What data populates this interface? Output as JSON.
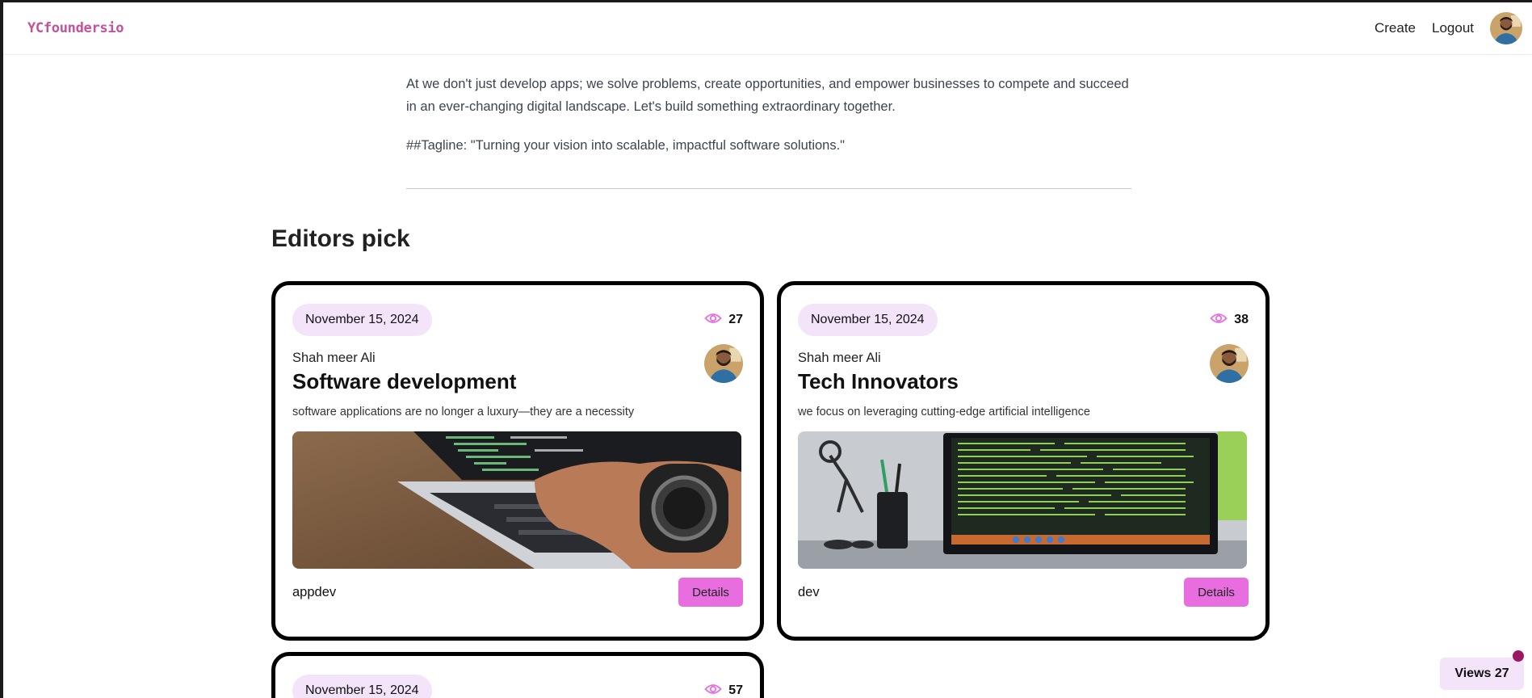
{
  "header": {
    "logo": "YCfoundersio",
    "nav": {
      "create": "Create",
      "logout": "Logout"
    }
  },
  "description": {
    "paragraph": "At we don't just develop apps; we solve problems, create opportunities, and empower businesses to compete and succeed in an ever-changing digital landscape. Let's build something extraordinary together.",
    "tagline": "##Tagline: \"Turning your vision into scalable, impactful software solutions.\""
  },
  "section_title": "Editors pick",
  "cards": [
    {
      "date": "November 15, 2024",
      "views": "27",
      "author": "Shah meer Ali",
      "title": "Software development",
      "description": "software applications are no longer a luxury—they are a necessity",
      "category": "appdev",
      "details_label": "Details"
    },
    {
      "date": "November 15, 2024",
      "views": "38",
      "author": "Shah meer Ali",
      "title": "Tech Innovators",
      "description": "we focus on leveraging cutting-edge artificial intelligence",
      "category": "dev",
      "details_label": "Details"
    },
    {
      "date": "November 15, 2024",
      "views": "57"
    }
  ],
  "views_badge": "Views 27",
  "icons": {
    "views": "eye-icon",
    "avatar": "user-avatar"
  },
  "colors": {
    "accent": "#e86ee0",
    "pill_bg": "#f3e4fa",
    "logo": "#c2539a",
    "ping": "#9c1860"
  }
}
